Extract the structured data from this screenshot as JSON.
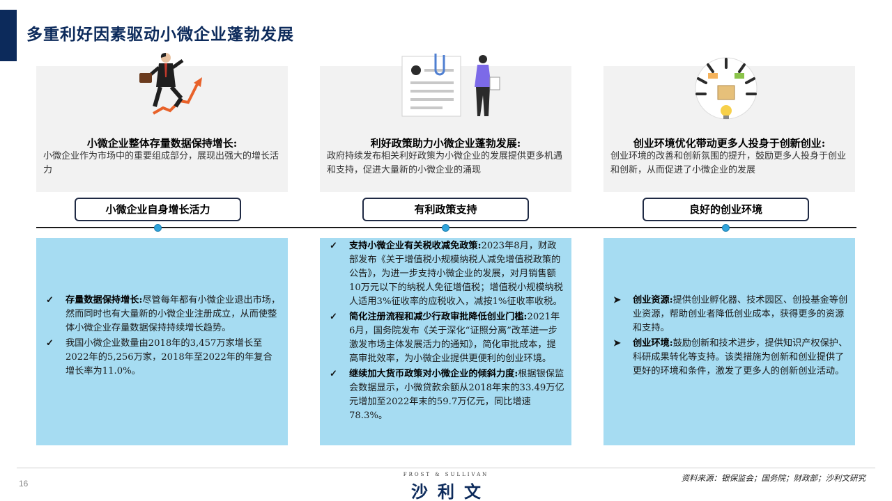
{
  "page_title": "多重利好因素驱动小微企业蓬勃发展",
  "columns": [
    {
      "heading": "小微企业整体存量数据保持增长:",
      "description": "小微企业作为市场中的重要组成部分，展现出强大的增长活力",
      "pill": "小微企业自身增长活力",
      "illustration_icon": "businessman-climbing-growth-arrow-icon",
      "bullet_icon": "checkmark-icon",
      "bullets": [
        {
          "bold": "存量数据保持增长:",
          "text": "尽管每年都有小微企业退出市场，然而同时也有大量新的小微企业注册成立，从而使整体小微企业存量数据保持持续增长趋势。"
        },
        {
          "bold": "",
          "text": "我国小微企业数量由2018年的3,457万家增长至2022年的5,256万家，2018年至2022年的年复合增长率为11.0%。"
        }
      ]
    },
    {
      "heading": "利好政策助力小微企业蓬勃发展:",
      "description": "政府持续发布相关利好政策为小微企业的发展提供更多机遇和支持，促进大量新的小微企业的涌现",
      "pill": "有利政策支持",
      "illustration_icon": "document-clip-woman-icon",
      "bullet_icon": "checkmark-icon",
      "bullets": [
        {
          "bold": "支持小微企业有关税收减免政策:",
          "text": "2023年8月，财政部发布《关于增值税小规模纳税人减免增值税政策的公告》，为进一步支持小微企业的发展，对月销售额10万元以下的纳税人免征增值税；增值税小规模纳税人适用3%征收率的应税收入，减按1%征收率收税。"
        },
        {
          "bold": "简化注册流程和减少行政审批降低创业门槛:",
          "text": "2021年6月，国务院发布《关于深化“证照分离”改革进一步激发市场主体发展活力的通知》，简化审批成本，提高审批效率，为小微企业提供更便利的创业环境。"
        },
        {
          "bold": "继续加大货币政策对小微企业的倾斜力度:",
          "text": "根据银保监会数据显示，小微贷款余额从2018年末的33.49万亿元增加至2022年末的59.7万亿元，同比增速78.3%。"
        }
      ]
    },
    {
      "heading": "创业环境优化带动更多人投身于创新创业:",
      "description": "创业环境的改善和创新氛围的提升，鼓励更多人投身于创业和创新，从而促进了小微企业的发展",
      "pill": "良好的创业环境",
      "illustration_icon": "hands-lightbulb-innovation-icon",
      "bullet_icon": "arrowhead-icon",
      "bullets": [
        {
          "bold": "创业资源:",
          "text": "提供创业孵化器、技术园区、创投基金等创业资源，帮助创业者降低创业成本，获得更多的资源和支持。"
        },
        {
          "bold": "创业环境:",
          "text": "鼓励创新和技术进步，提供知识产权保护、科研成果转化等支持。该类措施为创新和创业提供了更好的环境和条件，激发了更多人的创新创业活动。"
        }
      ]
    }
  ],
  "footer": {
    "page_number": "16",
    "logo_en": "FROST & SULLIVAN",
    "logo_cn": "沙利文",
    "source": "资料来源：银保监会；国务院；财政部；沙利文研究"
  },
  "colors": {
    "title_navy": "#0c2a5b",
    "card_grey": "#f2f2f2",
    "card_blue": "#a6dcf2",
    "timeline_dot": "#2fa4dc"
  }
}
